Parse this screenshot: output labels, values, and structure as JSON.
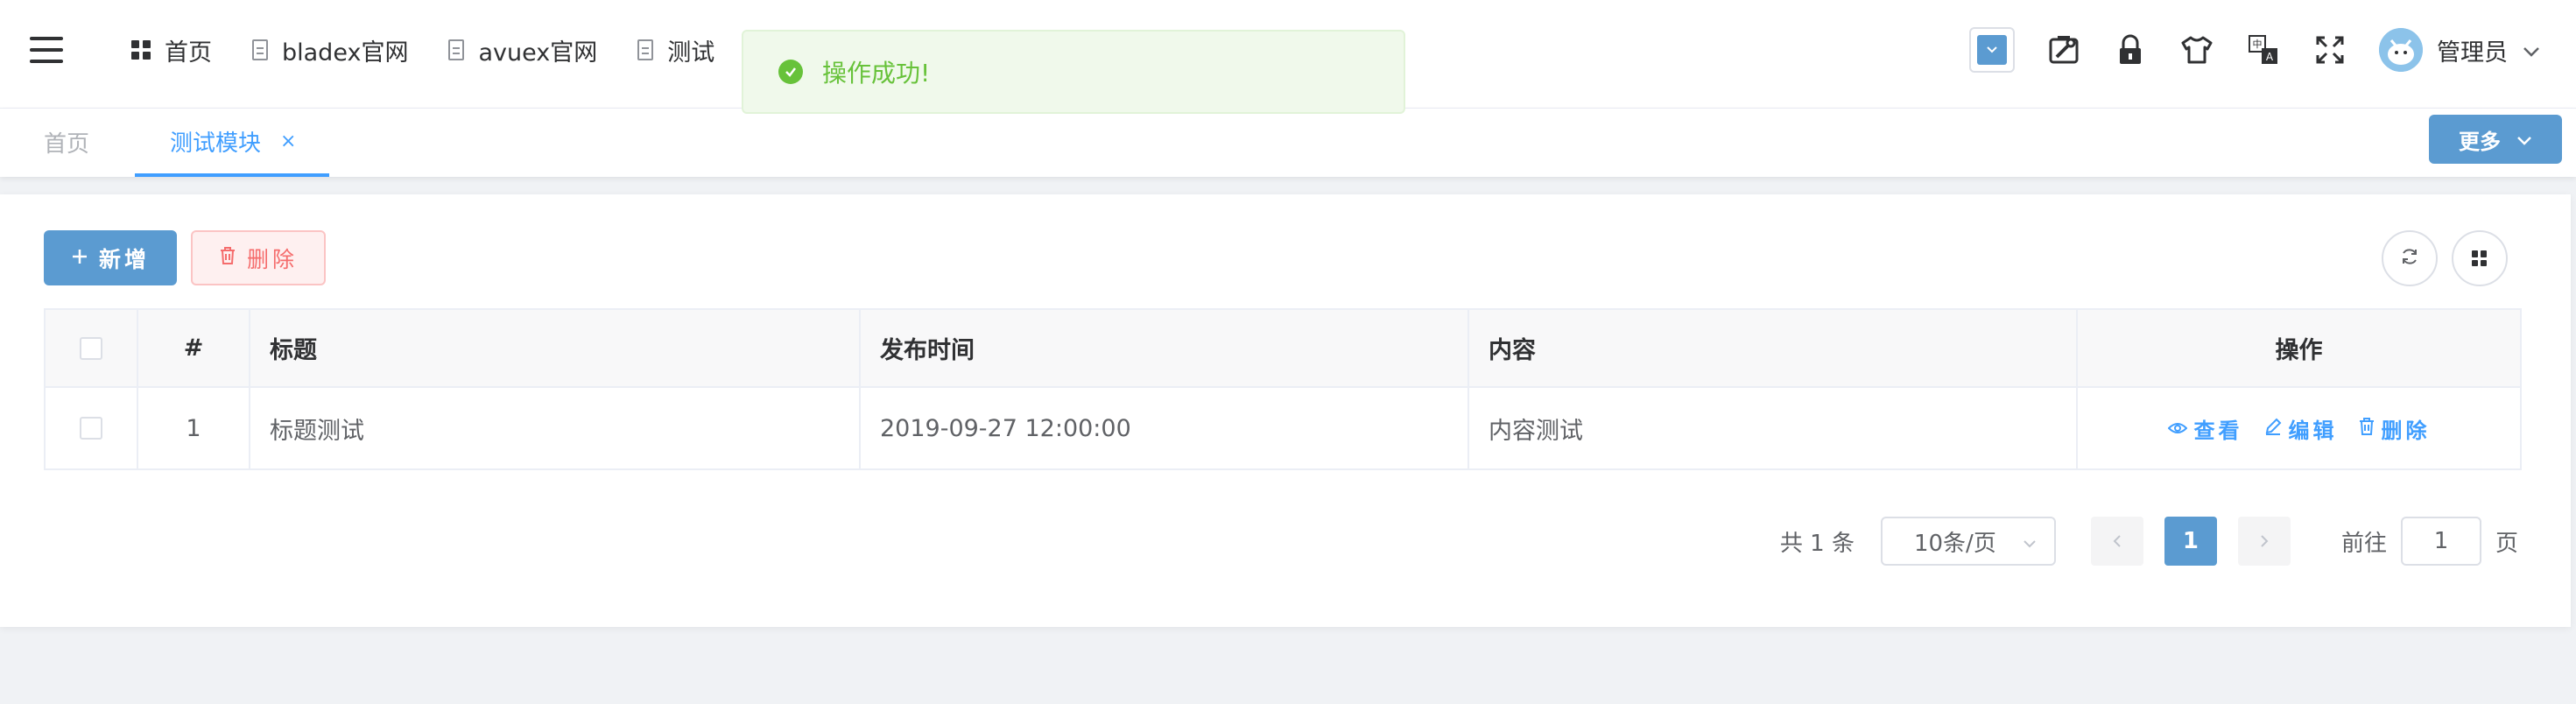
{
  "topnav": {
    "items": [
      {
        "label": "首页",
        "icon": "grid-icon"
      },
      {
        "label": "bladex官网",
        "icon": "document-icon"
      },
      {
        "label": "avuex官网",
        "icon": "document-icon"
      },
      {
        "label": "测试",
        "icon": "document-icon"
      }
    ]
  },
  "header": {
    "user_name": "管理员",
    "icons": [
      "theme-select-icon",
      "screen-lock-settings-icon",
      "lock-icon",
      "shirt-icon",
      "translate-icon",
      "fullscreen-icon"
    ]
  },
  "toast": {
    "message": "操作成功!",
    "type": "success",
    "color": "#67c23a"
  },
  "tabs": {
    "items": [
      {
        "label": "首页",
        "active": false
      },
      {
        "label": "测试模块",
        "active": true,
        "closable": true
      }
    ],
    "close_symbol": "×",
    "more_label": "更多"
  },
  "toolbar": {
    "add_label": "新增",
    "delete_label": "删除"
  },
  "table": {
    "headers": {
      "index": "#",
      "title": "标题",
      "time": "发布时间",
      "content": "内容",
      "ops": "操作"
    },
    "rows": [
      {
        "index": "1",
        "title": "标题测试",
        "time": "2019-09-27 12:00:00",
        "content": "内容测试"
      }
    ],
    "actions": {
      "view": "查看",
      "edit": "编辑",
      "delete": "删除"
    }
  },
  "pagination": {
    "total_text": "共 1 条",
    "page_size": "10条/页",
    "current_page": "1",
    "goto_prefix": "前往",
    "goto_value": "1",
    "goto_suffix": "页"
  },
  "colors": {
    "primary": "#409eff",
    "button_blue": "#5b9bd1",
    "danger": "#f56c6c",
    "success": "#67c23a"
  }
}
